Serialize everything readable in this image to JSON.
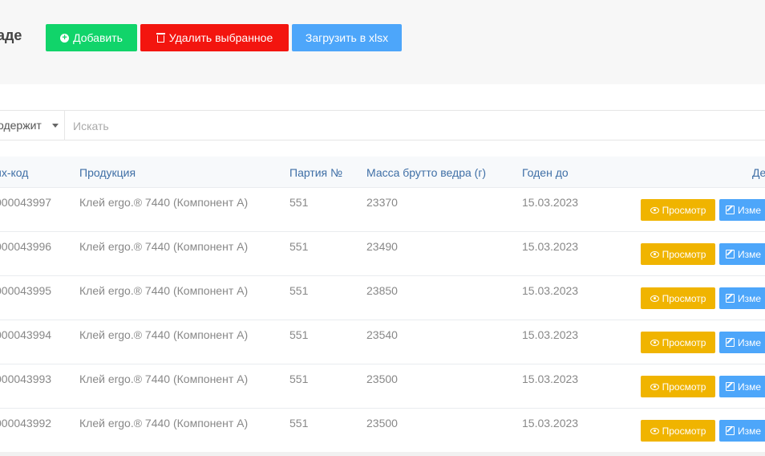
{
  "header": {
    "title": "аде",
    "add_label": "Добавить",
    "delete_label": "Удалить выбранное",
    "xlsx_label": "Загрузить в xlsx"
  },
  "search": {
    "filter_value": "одержит",
    "placeholder": "Искать"
  },
  "table": {
    "columns": [
      "их-код",
      "Продукция",
      "Партия №",
      "Масса брутто ведра (г)",
      "Годен до",
      "Де"
    ],
    "rows": [
      {
        "code": "000043997",
        "product": "Клей ergo.® 7440 (Компонент А)",
        "batch": "551",
        "mass": "23370",
        "date": "15.03.2023"
      },
      {
        "code": "000043996",
        "product": "Клей ergo.® 7440 (Компонент А)",
        "batch": "551",
        "mass": "23490",
        "date": "15.03.2023"
      },
      {
        "code": "000043995",
        "product": "Клей ergo.® 7440 (Компонент А)",
        "batch": "551",
        "mass": "23850",
        "date": "15.03.2023"
      },
      {
        "code": "000043994",
        "product": "Клей ergo.® 7440 (Компонент А)",
        "batch": "551",
        "mass": "23540",
        "date": "15.03.2023"
      },
      {
        "code": "000043993",
        "product": "Клей ergo.® 7440 (Компонент А)",
        "batch": "551",
        "mass": "23500",
        "date": "15.03.2023"
      },
      {
        "code": "000043992",
        "product": "Клей ergo.® 7440 (Компонент А)",
        "batch": "551",
        "mass": "23500",
        "date": "15.03.2023"
      }
    ],
    "view_label": "Просмотр",
    "edit_label": "Изме"
  },
  "colors": {
    "add": "#11d46a",
    "delete": "#f3150f",
    "xlsx": "#4da6fa",
    "view": "#f0b400",
    "edit": "#4da6fa",
    "header_text": "#3f6fa6"
  }
}
